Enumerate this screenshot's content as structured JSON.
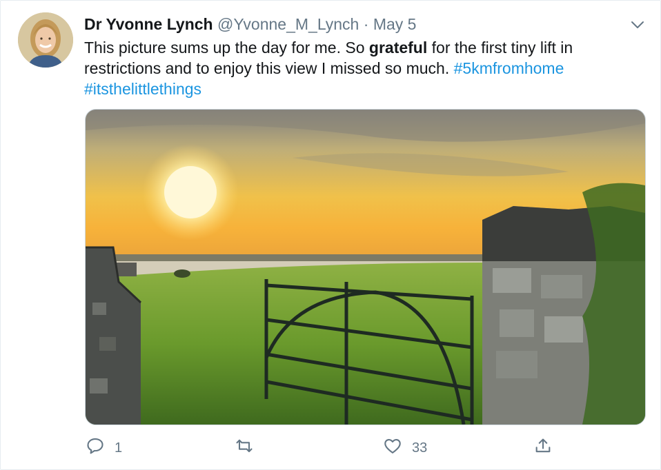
{
  "tweet": {
    "author_name": "Dr Yvonne Lynch",
    "handle": "@Yvonne_M_Lynch",
    "separator": "·",
    "date": "May 5",
    "text_before": "This picture sums up the day for me. So ",
    "text_bold": "grateful",
    "text_after": " for the first tiny lift in restrictions and to enjoy this view I missed so much. ",
    "hashtags": [
      "#5kmfromhome",
      "#itsthelittlethings"
    ]
  },
  "actions": {
    "reply_count": "1",
    "retweet_count": "",
    "like_count": "33"
  },
  "icons": {
    "reply": "reply-icon",
    "retweet": "retweet-icon",
    "like": "heart-icon",
    "share": "share-icon",
    "menu": "chevron-down-icon"
  },
  "colors": {
    "link": "#1b95e0",
    "muted": "#657786",
    "text": "#14171a"
  }
}
